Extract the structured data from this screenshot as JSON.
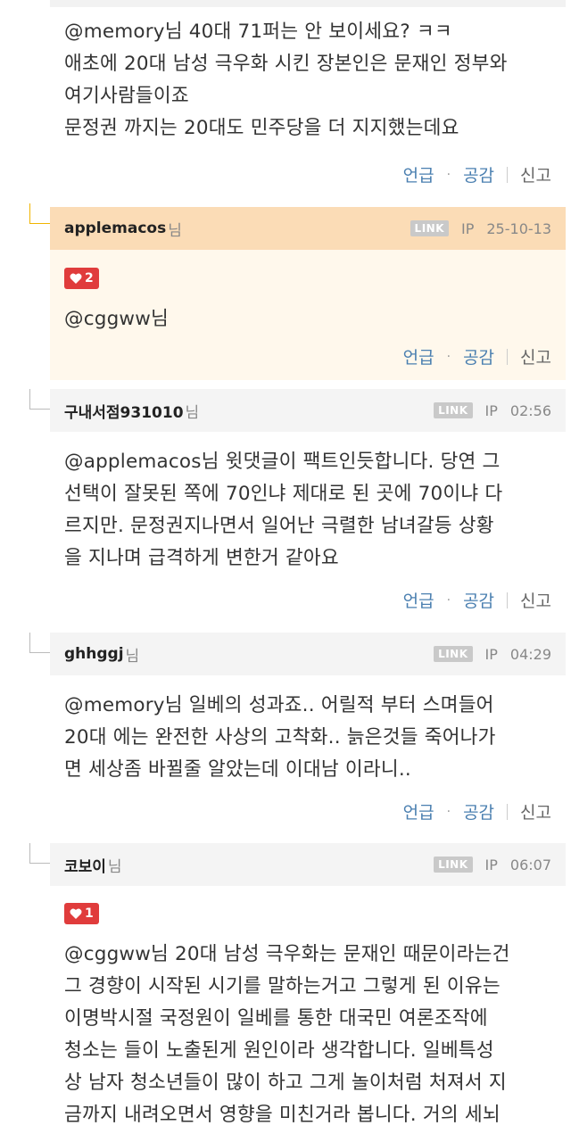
{
  "comments": [
    {
      "text": "@memory님 40대 71퍼는 안 보이세요? ㅋㅋ\n애초에 20대 남성 극우화 시킨 장본인은 문재인 정부와\n여기사람들이죠\n문정권 까지는 20대도 민주당을 더 지지했는데요",
      "actions": {
        "mention": "언급",
        "agree": "공감",
        "report": "신고"
      }
    },
    {
      "author": "applemacos",
      "nim": "님",
      "link": "LINK",
      "ip": "IP",
      "date": "25-10-13",
      "likes": "2",
      "text": "@cggww님",
      "actions": {
        "mention": "언급",
        "agree": "공감",
        "report": "신고"
      }
    },
    {
      "author": "구내서점931010",
      "nim": "님",
      "link": "LINK",
      "ip": "IP",
      "date": "02:56",
      "text": "@applemacos님 윗댓글이 팩트인듯합니다. 당연 그\n선택이 잘못된 쪽에 70인냐 제대로 된 곳에 70이냐 다\n르지만. 문정권지나면서 일어난 극렬한 남녀갈등 상황\n을 지나며 급격하게 변한거 같아요",
      "actions": {
        "mention": "언급",
        "agree": "공감",
        "report": "신고"
      }
    },
    {
      "author": "ghhggj",
      "nim": "님",
      "link": "LINK",
      "ip": "IP",
      "date": "04:29",
      "text": "@memory님 일베의 성과죠.. 어릴적 부터 스며들어\n20대 에는 완전한 사상의 고착화.. 늙은것들 죽어나가\n면 세상좀 바뀔줄 알았는데 이대남 이라니..",
      "actions": {
        "mention": "언급",
        "agree": "공감",
        "report": "신고"
      }
    },
    {
      "author": "코보이",
      "nim": "님",
      "link": "LINK",
      "ip": "IP",
      "date": "06:07",
      "likes": "1",
      "text": "@cggww님 20대 남성 극우화는 문재인 때문이라는건\n그 경향이 시작된 시기를 말하는거고 그렇게 된 이유는\n이명박시절 국정원이 일베를 통한 대국민 여론조작에\n청소는 들이 노출된게 원인이라 생각합니다. 일베특성\n상 남자 청소년들이 많이 하고 그게 놀이처럼 처져서 지\n금까지 내려오면서 영향을 미친거라 봅니다. 거의 세뇌"
    }
  ],
  "colors": {
    "highlight_header": "#fbdcb6",
    "highlight_body": "#fff8ec",
    "like_red": "#e03c3c",
    "action_blue": "#4a7fb0"
  }
}
